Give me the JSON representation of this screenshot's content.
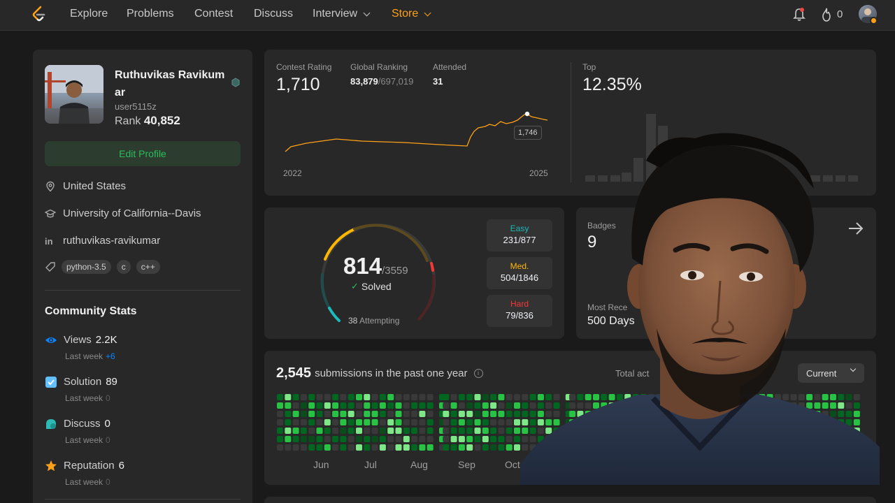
{
  "nav": {
    "items": [
      "Explore",
      "Problems",
      "Contest",
      "Discuss",
      "Interview",
      "Store"
    ],
    "streak": "0"
  },
  "profile": {
    "name": "Ruthuvikas Ravikumar",
    "username": "user5115z",
    "rank_label": "Rank",
    "rank_value": "40,852",
    "edit_button": "Edit Profile",
    "location": "United States",
    "school": "University of California--Davis",
    "linkedin": "ruthuvikas-ravikumar",
    "skills": [
      "python-3.5",
      "c",
      "c++"
    ]
  },
  "community": {
    "title": "Community Stats",
    "stats": [
      {
        "label": "Views",
        "value": "2.2K",
        "sub": "Last week",
        "delta": "+6",
        "icon": "eye-icon",
        "color": "#0a84ff"
      },
      {
        "label": "Solution",
        "value": "89",
        "sub": "Last week",
        "delta": "0",
        "icon": "solution-icon",
        "color": "#62c0ff"
      },
      {
        "label": "Discuss",
        "value": "0",
        "sub": "Last week",
        "delta": "0",
        "icon": "discuss-icon",
        "color": "#2cbbb4"
      },
      {
        "label": "Reputation",
        "value": "6",
        "sub": "Last week",
        "delta": "0",
        "icon": "star-icon",
        "color": "#ffa116"
      }
    ]
  },
  "contest": {
    "rating_label": "Contest Rating",
    "rating_value": "1,710",
    "ranking_label": "Global Ranking",
    "ranking_value": "83,879",
    "ranking_total": "/697,019",
    "attended_label": "Attended",
    "attended_value": "31",
    "top_label": "Top",
    "top_value": "12.35%",
    "year_start": "2022",
    "year_end": "2025",
    "tooltip": "1,746",
    "line_color": "#ffa116"
  },
  "chart_data": {
    "type": "line",
    "x": [
      "2022",
      "2025"
    ],
    "series": [],
    "xlabel": "",
    "ylabel": ""
  },
  "solved": {
    "count": "814",
    "total": "/3559",
    "label": "Solved",
    "attempting_count": "38",
    "attempting_label": "Attempting",
    "easy_label": "Easy",
    "easy_value": "231/877",
    "med_label": "Med.",
    "med_value": "504/1846",
    "hard_label": "Hard",
    "hard_value": "79/836",
    "colors": {
      "easy": "#1cbaba",
      "med": "#ffb700",
      "hard": "#f63737"
    }
  },
  "badges": {
    "label": "Badges",
    "count": "9",
    "recent_label": "Most Rece",
    "recent_value": "500 Days"
  },
  "heatmap": {
    "count": "2,545",
    "text": "submissions in the past one year",
    "total_active": "Total act",
    "select": "Current",
    "months": [
      "Jun",
      "Jul",
      "Aug",
      "Sep",
      "Oct"
    ]
  }
}
